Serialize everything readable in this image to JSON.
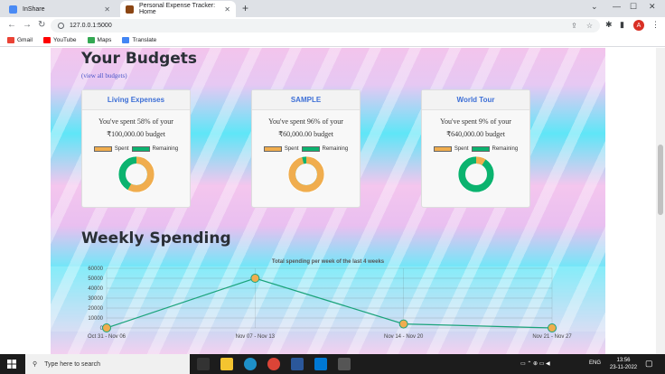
{
  "browser": {
    "tabs": [
      {
        "title": "InShare",
        "favicon_color": "#4a8af4"
      },
      {
        "title": "Personal Expense Tracker: Home",
        "favicon_color": "#8b4513"
      }
    ],
    "url": "127.0.0.1:5000",
    "avatar_letter": "A",
    "bookmarks": [
      {
        "label": "Gmail",
        "color": "#ea4335"
      },
      {
        "label": "YouTube",
        "color": "#ff0000"
      },
      {
        "label": "Maps",
        "color": "#34a853"
      },
      {
        "label": "Translate",
        "color": "#4285f4"
      }
    ]
  },
  "budgets": {
    "title": "Your Budgets",
    "view_all": "(view all budgets)",
    "legend_spent": "Spent",
    "legend_remaining": "Remaining",
    "spent_color": "#f0ad4e",
    "remaining_color": "#0bb36f",
    "cards": [
      {
        "name": "Living Expenses",
        "line1": "You've spent 58% of your",
        "line2": "₹100,000.00 budget",
        "spent_pct": 58
      },
      {
        "name": "SAMPLE",
        "line1": "You've spent 96% of your",
        "line2": "₹60,000.00 budget",
        "spent_pct": 96
      },
      {
        "name": "World Tour",
        "line1": "You've spent 9% of your",
        "line2": "₹640,000.00 budget",
        "spent_pct": 9
      }
    ]
  },
  "weekly": {
    "title": "Weekly Spending"
  },
  "chart_data": {
    "type": "line",
    "title": "Total spending per week of the last 4 weeks",
    "categories": [
      "Oct 31 - Nov 06",
      "Nov 07 - Nov 13",
      "Nov 14 - Nov 20",
      "Nov 21 - Nov 27"
    ],
    "values": [
      0,
      50000,
      4000,
      0
    ],
    "yticks": [
      "60000",
      "50000",
      "40000",
      "30000",
      "20000",
      "10000",
      "0"
    ],
    "ylim": [
      0,
      60000
    ],
    "grid": true,
    "line_color": "#1aa37a",
    "point_color": "#f0ad4e"
  },
  "taskbar": {
    "search_placeholder": "Type here to search",
    "lang": "ENG",
    "time": "13:56",
    "date": "23-11-2022"
  }
}
